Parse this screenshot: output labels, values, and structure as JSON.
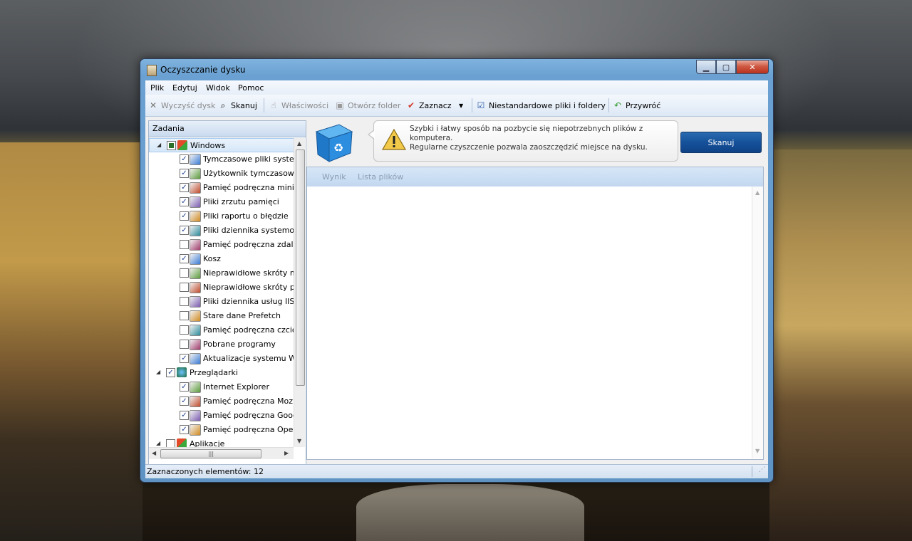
{
  "window": {
    "title": "Oczyszczanie dysku"
  },
  "menu": [
    "Plik",
    "Edytuj",
    "Widok",
    "Pomoc"
  ],
  "toolbar": {
    "clean": "Wyczyść dysk",
    "scan": "Skanuj",
    "properties": "Właściwości",
    "open_folder": "Otwórz folder",
    "select": "Zaznacz",
    "custom": "Niestandardowe pliki i foldery",
    "restore": "Przywróć"
  },
  "tasks": {
    "header": "Zadania",
    "groups": [
      {
        "label": "Windows",
        "checked": "mixed",
        "items": [
          {
            "label": "Tymczasowe pliki systemu",
            "checked": true
          },
          {
            "label": "Użytkownik tymczasowy",
            "checked": true
          },
          {
            "label": "Pamięć podręczna miniatur",
            "checked": true
          },
          {
            "label": "Pliki zrzutu pamięci",
            "checked": true
          },
          {
            "label": "Pliki raportu o błędzie",
            "checked": true
          },
          {
            "label": "Pliki dziennika systemoweg",
            "checked": true
          },
          {
            "label": "Pamięć podręczna zdalneg",
            "checked": false
          },
          {
            "label": "Kosz",
            "checked": true
          },
          {
            "label": "Nieprawidłowe skróty men",
            "checked": false
          },
          {
            "label": "Nieprawidłowe skróty pulp",
            "checked": false
          },
          {
            "label": "Pliki dziennika usług IIS",
            "checked": false
          },
          {
            "label": "Stare dane Prefetch",
            "checked": false
          },
          {
            "label": "Pamięć podręczna czcionki",
            "checked": false
          },
          {
            "label": "Pobrane programy",
            "checked": false
          },
          {
            "label": "Aktualizacje systemu Wind",
            "checked": true
          }
        ]
      },
      {
        "label": "Przeglądarki",
        "checked": true,
        "items": [
          {
            "label": "Internet Explorer",
            "checked": true
          },
          {
            "label": "Pamięć podręczna Mozilla F",
            "checked": true
          },
          {
            "label": "Pamięć podręczna Google (",
            "checked": true
          },
          {
            "label": "Pamięć podręczna Opera",
            "checked": true
          }
        ]
      },
      {
        "label": "Aplikacje",
        "checked": false,
        "items": []
      }
    ]
  },
  "info": {
    "lines": [
      "Szybki i łatwy sposób na pozbycie się niepotrzebnych plików z",
      "komputera.",
      "Regularne czyszczenie pozwala zaoszczędzić miejsce na dysku."
    ],
    "scan_button": "Skanuj"
  },
  "results": {
    "tabs": [
      "Wynik",
      "Lista plików"
    ]
  },
  "status": {
    "text": "Zaznaczonych elementów: 12"
  }
}
